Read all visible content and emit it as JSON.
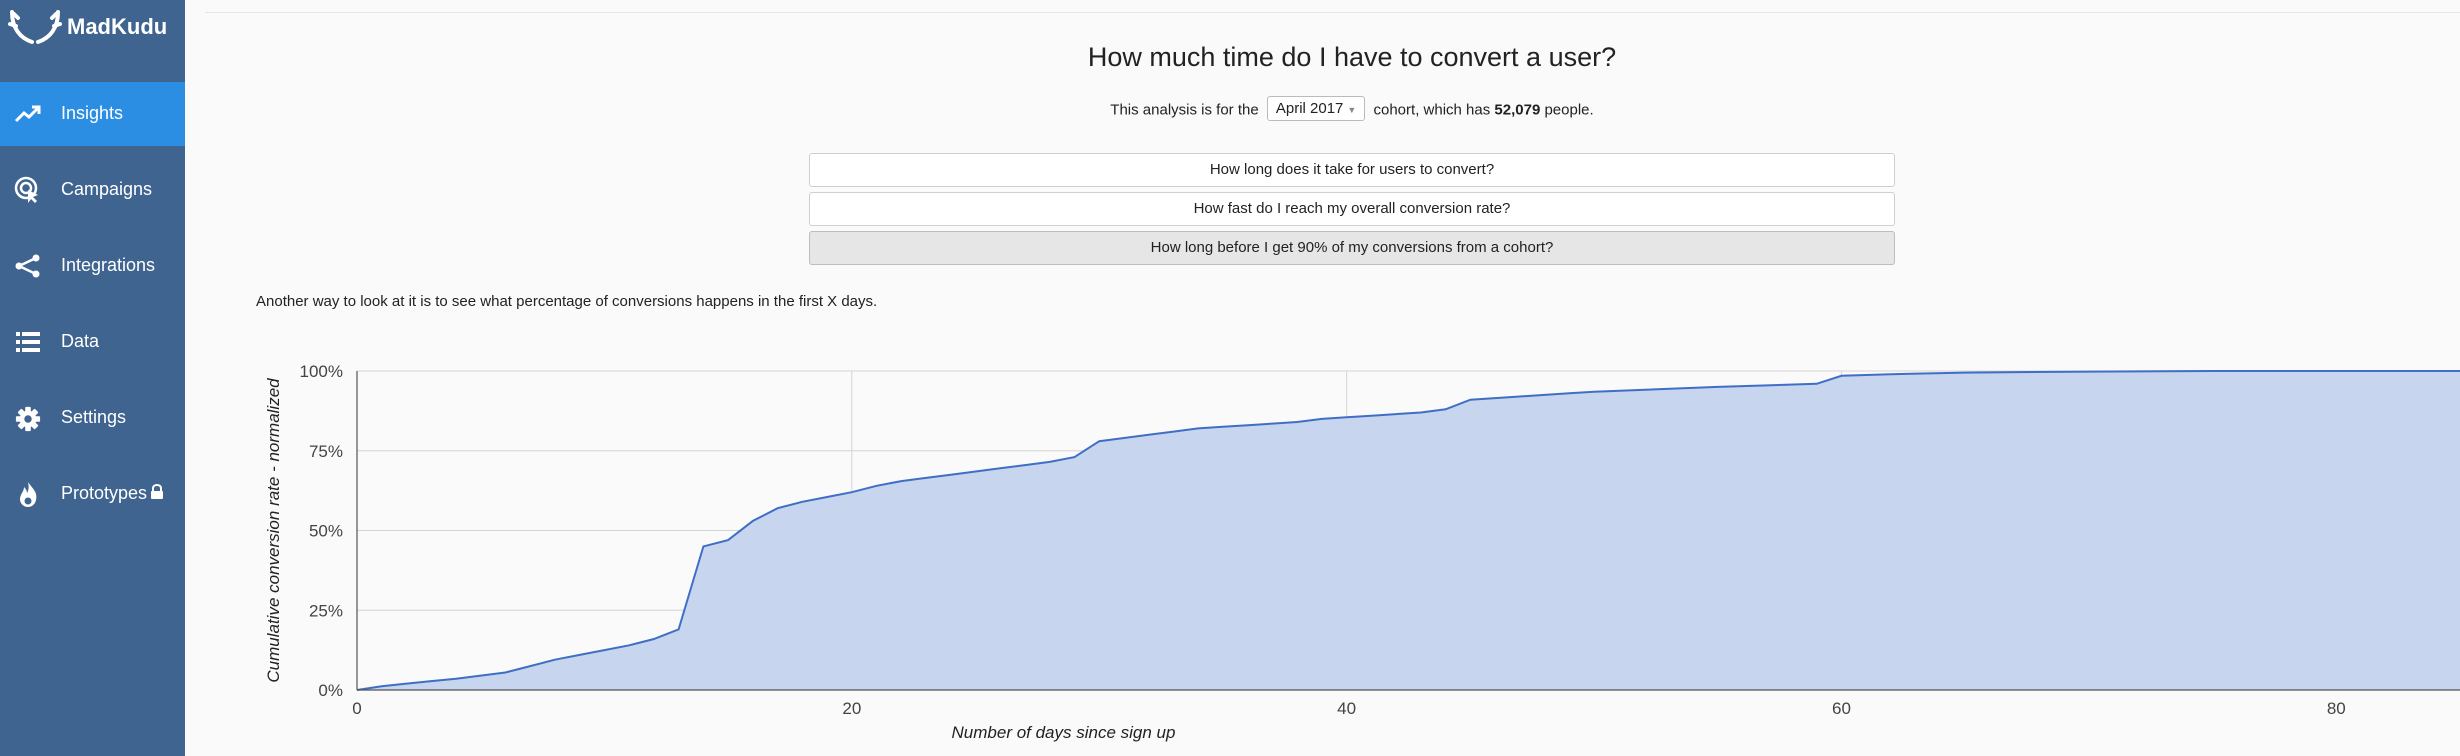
{
  "app": {
    "name": "MadKudu"
  },
  "sidebar": {
    "items": [
      {
        "label": "Insights",
        "icon": "trending-up-icon",
        "active": true
      },
      {
        "label": "Campaigns",
        "icon": "target-cursor-icon",
        "active": false
      },
      {
        "label": "Integrations",
        "icon": "share-icon",
        "active": false
      },
      {
        "label": "Data",
        "icon": "list-icon",
        "active": false
      },
      {
        "label": "Settings",
        "icon": "gear-icon",
        "active": false
      },
      {
        "label": "Prototypes",
        "icon": "flame-icon",
        "active": false,
        "badge_icon": "lock-icon"
      }
    ]
  },
  "page": {
    "title": "How much time do I have to convert a user?",
    "subline_prefix": "This analysis is for the",
    "cohort": "April 2017",
    "subline_middle": "cohort, which has",
    "people_count": "52,079",
    "subline_suffix": "people.",
    "questions": [
      "How long does it take for users to convert?",
      "How fast do I reach my overall conversion rate?",
      "How long before I get 90% of my conversions from a cohort?"
    ],
    "active_question_index": 2,
    "note": "Another way to look at it is to see what percentage of conversions happens in the first X days."
  },
  "colors": {
    "sidebar": "#3f6490",
    "active": "#2b8ee2",
    "line": "#3f6fc4",
    "fill": "#c7d5ef"
  },
  "chart_data": {
    "type": "area",
    "xlabel": "Number of days since sign up",
    "ylabel": "Cumulative conversion rate - normalized",
    "xlim": [
      0,
      85
    ],
    "ylim": [
      0,
      100
    ],
    "x_ticks": [
      0,
      20,
      40,
      60,
      80
    ],
    "y_ticks": [
      0,
      25,
      50,
      75,
      100
    ],
    "y_tick_labels": [
      "0%",
      "25%",
      "50%",
      "75%",
      "100%"
    ],
    "grid": true,
    "series": [
      {
        "x": [
          0,
          1,
          2,
          3,
          4,
          5,
          6,
          7,
          8,
          9,
          10,
          11,
          12,
          13,
          14,
          15,
          16,
          17,
          18,
          19,
          20,
          21,
          22,
          23,
          24,
          25,
          26,
          27,
          28,
          29,
          30,
          31,
          32,
          33,
          34,
          35,
          36,
          37,
          38,
          39,
          40,
          41,
          42,
          43,
          44,
          45,
          46,
          47,
          48,
          49,
          50,
          55,
          57,
          59,
          60,
          62,
          65,
          70,
          75,
          80,
          85
        ],
        "y": [
          0,
          1.2,
          2,
          2.8,
          3.5,
          4.5,
          5.5,
          7.5,
          9.5,
          11,
          12.5,
          14,
          16,
          19,
          45,
          47,
          53,
          57,
          59,
          60.5,
          62,
          64,
          65.5,
          66.5,
          67.5,
          68.5,
          69.5,
          70.5,
          71.5,
          73,
          78,
          79,
          80,
          81,
          82,
          82.5,
          83,
          83.5,
          84,
          85,
          85.5,
          86,
          86.5,
          87,
          88,
          91,
          91.5,
          92,
          92.5,
          93,
          93.5,
          95,
          95.5,
          96,
          98.5,
          99,
          99.5,
          99.8,
          100,
          100,
          100
        ]
      }
    ]
  }
}
